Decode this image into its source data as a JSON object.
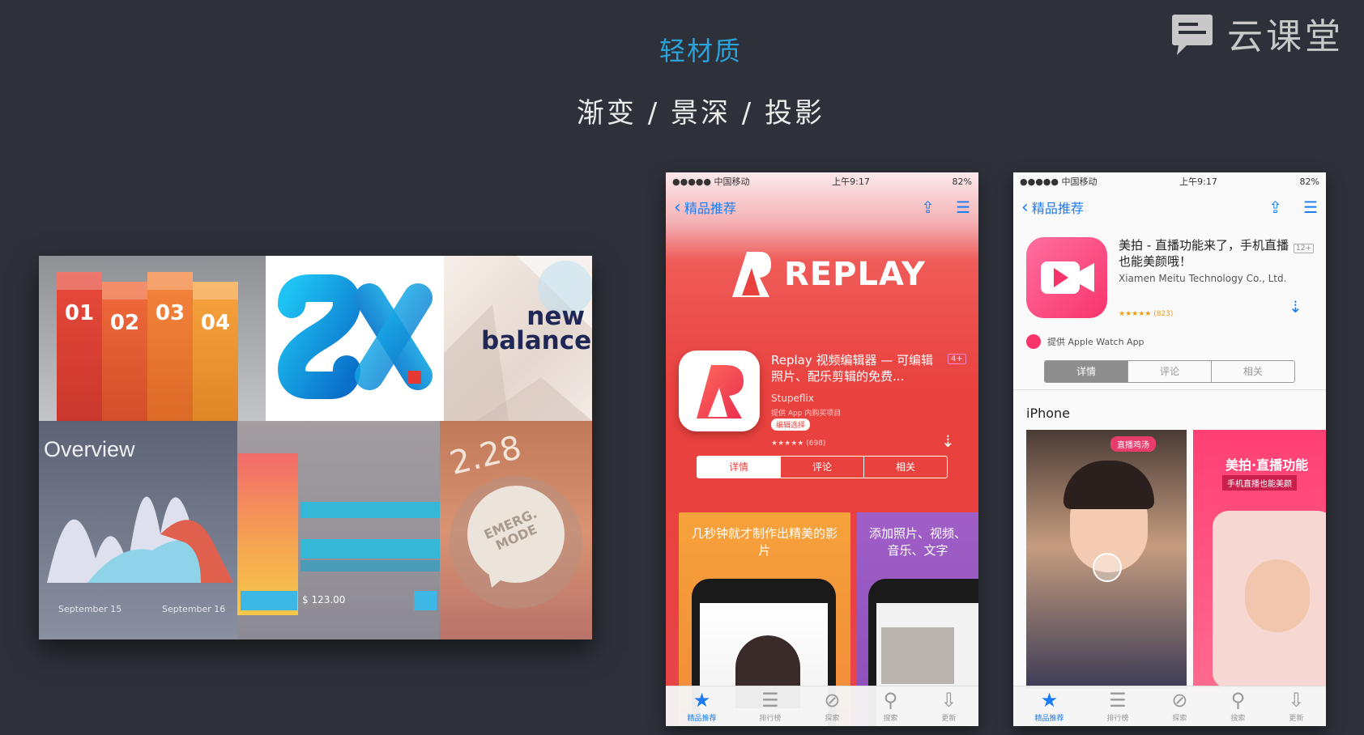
{
  "slide": {
    "title": "轻材质",
    "subtitle": "渐变 / 景深 / 投影",
    "brand_text": "云课堂"
  },
  "collage": {
    "ribbons": [
      "01",
      "02",
      "03",
      "04"
    ],
    "colors": [
      "#e84a3b",
      "#f06a3a",
      "#f5853d",
      "#f7a43f"
    ],
    "nb_line1": "new",
    "nb_line2": "balance",
    "overview_title": "Overview",
    "overview_date1": "September 15",
    "overview_date2": "September 16",
    "price": "$ 123.00",
    "clock": "2.28",
    "emerg": "EMERG.",
    "mode": "MODE"
  },
  "phone1": {
    "carrier": "●●●●● 中国移动",
    "time": "上午9:17",
    "battery": "82%",
    "back_label": "精品推荐",
    "banner": "REPLAY",
    "app_name": "Replay 视频编辑器 — 可编辑照片、配乐剪辑的免费...",
    "age": "4+",
    "developer": "Stupeflix",
    "iap": "提供 App 内购买项目",
    "badge": "编辑选择",
    "rating": "★★★★★ (698)",
    "segments": [
      "详情",
      "评论",
      "相关"
    ],
    "shot1": "几秒钟就才制作出精美的影片",
    "shot2": "添加照片、视频、音乐、文字"
  },
  "phone2": {
    "carrier": "●●●●● 中国移动",
    "time": "上午9:17",
    "battery": "82%",
    "back_label": "精品推荐",
    "app_name": "美拍 - 直播功能来了，手机直播也能美颜哦！",
    "age": "12+",
    "developer": "Xiamen Meitu Technology Co., Ltd.",
    "rating": "★★★★★ (823)",
    "watch": "提供 Apple Watch App",
    "segments": [
      "详情",
      "评论",
      "相关"
    ],
    "section": "iPhone",
    "live_tag": "直播鸡汤",
    "promo": "美拍·直播功能",
    "promo_sub": "手机直播也能美颜"
  },
  "tabbar": {
    "items": [
      {
        "icon": "star-icon",
        "glyph": "★",
        "label": "精品推荐"
      },
      {
        "icon": "list-icon",
        "glyph": "☰",
        "label": "排行榜"
      },
      {
        "icon": "compass-icon",
        "glyph": "⊘",
        "label": "探索"
      },
      {
        "icon": "search-icon",
        "glyph": "⚲",
        "label": "搜索"
      },
      {
        "icon": "download-icon",
        "glyph": "⇩",
        "label": "更新"
      }
    ]
  }
}
